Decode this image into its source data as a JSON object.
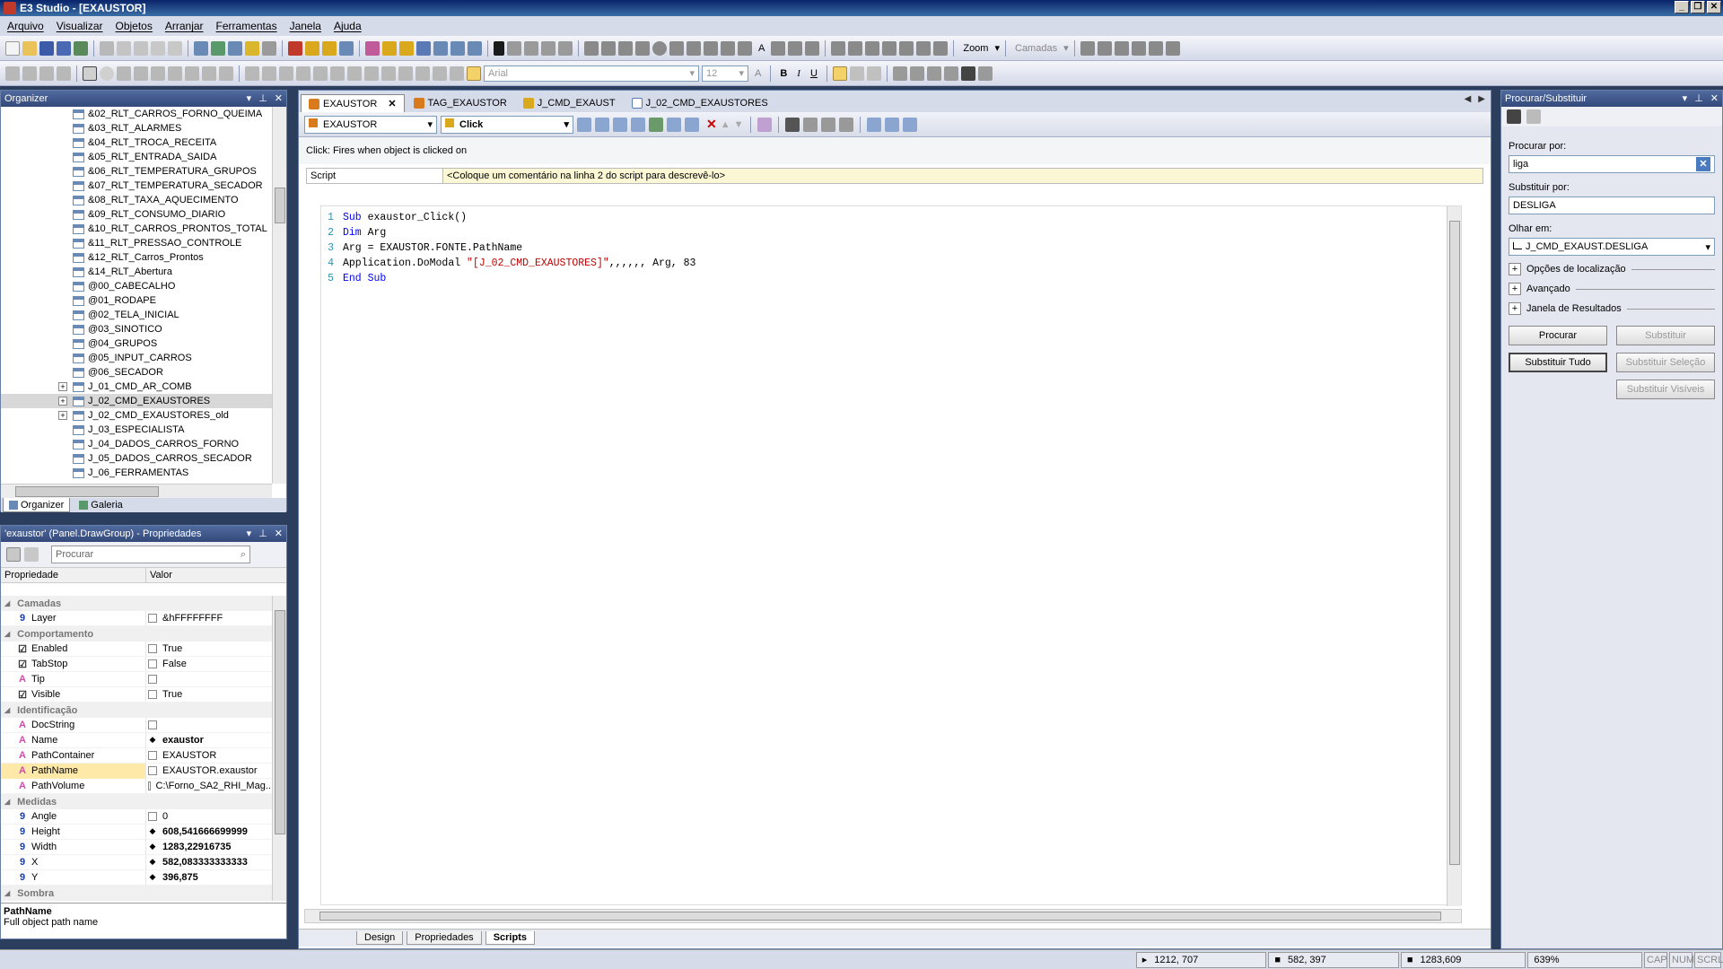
{
  "window": {
    "title": "E3 Studio - [EXAUSTOR]",
    "btn_min": "_",
    "btn_restore": "❐",
    "btn_close": "✕"
  },
  "menu": [
    "Arquivo",
    "Visualizar",
    "Objetos",
    "Arranjar",
    "Ferramentas",
    "Janela",
    "Ajuda"
  ],
  "toolbar": {
    "zoom_label": "Zoom",
    "layers_label": "Camadas",
    "font_name": "Arial",
    "font_size": "12",
    "bold": "B",
    "italic": "I",
    "underline": "U",
    "text_tool": "A"
  },
  "organizer": {
    "title": "Organizer",
    "items": [
      {
        "label": "&02_RLT_CARROS_FORNO_QUEIMA",
        "expand": ""
      },
      {
        "label": "&03_RLT_ALARMES",
        "expand": ""
      },
      {
        "label": "&04_RLT_TROCA_RECEITA",
        "expand": ""
      },
      {
        "label": "&05_RLT_ENTRADA_SAIDA",
        "expand": ""
      },
      {
        "label": "&06_RLT_TEMPERATURA_GRUPOS",
        "expand": ""
      },
      {
        "label": "&07_RLT_TEMPERATURA_SECADOR",
        "expand": ""
      },
      {
        "label": "&08_RLT_TAXA_AQUECIMENTO",
        "expand": ""
      },
      {
        "label": "&09_RLT_CONSUMO_DIARIO",
        "expand": ""
      },
      {
        "label": "&10_RLT_CARROS_PRONTOS_TOTAL",
        "expand": ""
      },
      {
        "label": "&11_RLT_PRESSAO_CONTROLE",
        "expand": ""
      },
      {
        "label": "&12_RLT_Carros_Prontos",
        "expand": ""
      },
      {
        "label": "&14_RLT_Abertura",
        "expand": ""
      },
      {
        "label": "@00_CABECALHO",
        "expand": ""
      },
      {
        "label": "@01_RODAPE",
        "expand": ""
      },
      {
        "label": "@02_TELA_INICIAL",
        "expand": ""
      },
      {
        "label": "@03_SINOTICO",
        "expand": ""
      },
      {
        "label": "@04_GRUPOS",
        "expand": ""
      },
      {
        "label": "@05_INPUT_CARROS",
        "expand": ""
      },
      {
        "label": "@06_SECADOR",
        "expand": ""
      },
      {
        "label": "J_01_CMD_AR_COMB",
        "expand": "+"
      },
      {
        "label": "J_02_CMD_EXAUSTORES",
        "expand": "+"
      },
      {
        "label": "J_02_CMD_EXAUSTORES_old",
        "expand": "+"
      },
      {
        "label": "J_03_ESPECIALISTA",
        "expand": ""
      },
      {
        "label": "J_04_DADOS_CARROS_FORNO",
        "expand": ""
      },
      {
        "label": "J_05_DADOS_CARROS_SECADOR",
        "expand": ""
      },
      {
        "label": "J_06_FERRAMENTAS",
        "expand": ""
      }
    ],
    "selected": "J_02_CMD_EXAUSTORES",
    "tabs": [
      "Organizer",
      "Galeria"
    ]
  },
  "properties": {
    "title": "'exaustor' (Panel.DrawGroup) - Propriedades",
    "search_placeholder": "Procurar",
    "col_property": "Propriedade",
    "col_value": "Valor",
    "categories": [
      {
        "name": "Camadas",
        "rows": [
          {
            "type": "9",
            "type_color": "#1a3ea8",
            "name": "Layer",
            "mark": "box",
            "value": "&hFFFFFFFF",
            "bold": false
          }
        ]
      },
      {
        "name": "Comportamento",
        "rows": [
          {
            "type": "☑",
            "type_color": "#222222",
            "name": "Enabled",
            "mark": "box",
            "value": "True",
            "bold": false
          },
          {
            "type": "☑",
            "type_color": "#222222",
            "name": "TabStop",
            "mark": "box",
            "value": "False",
            "bold": false
          },
          {
            "type": "A",
            "type_color": "#d24aa8",
            "name": "Tip",
            "mark": "box",
            "value": "",
            "bold": false
          },
          {
            "type": "☑",
            "type_color": "#222222",
            "name": "Visible",
            "mark": "box",
            "value": "True",
            "bold": false
          }
        ]
      },
      {
        "name": "Identificação",
        "rows": [
          {
            "type": "A",
            "type_color": "#d24aa8",
            "name": "DocString",
            "mark": "box",
            "value": "",
            "bold": false
          },
          {
            "type": "A",
            "type_color": "#d24aa8",
            "name": "Name",
            "mark": "diamond",
            "value": "exaustor",
            "bold": true
          },
          {
            "type": "A",
            "type_color": "#d24aa8",
            "name": "PathContainer",
            "mark": "box",
            "value": "EXAUSTOR",
            "bold": false
          },
          {
            "type": "A",
            "type_color": "#d24aa8",
            "name": "PathName",
            "mark": "box",
            "value": "EXAUSTOR.exaustor",
            "bold": false,
            "selected": true
          },
          {
            "type": "A",
            "type_color": "#d24aa8",
            "name": "PathVolume",
            "mark": "box",
            "value": "C:\\Forno_SA2_RHI_Mag...",
            "bold": false
          }
        ]
      },
      {
        "name": "Medidas",
        "rows": [
          {
            "type": "9",
            "type_color": "#1a3ea8",
            "name": "Angle",
            "mark": "box",
            "value": "0",
            "bold": false
          },
          {
            "type": "9",
            "type_color": "#1a3ea8",
            "name": "Height",
            "mark": "diamond",
            "value": "608,541666699999",
            "bold": true
          },
          {
            "type": "9",
            "type_color": "#1a3ea8",
            "name": "Width",
            "mark": "diamond",
            "value": "1283,22916735",
            "bold": true
          },
          {
            "type": "9",
            "type_color": "#1a3ea8",
            "name": "X",
            "mark": "diamond",
            "value": "582,083333333333",
            "bold": true
          },
          {
            "type": "9",
            "type_color": "#1a3ea8",
            "name": "Y",
            "mark": "diamond",
            "value": "396,875",
            "bold": true
          }
        ]
      },
      {
        "name": "Sombra",
        "rows": []
      }
    ],
    "desc_title": "PathName",
    "desc_text": "Full object path name"
  },
  "editor": {
    "tabs": [
      {
        "label": "EXAUSTOR",
        "active": true,
        "color": "#d97b1c"
      },
      {
        "label": "TAG_EXAUSTOR",
        "active": false,
        "color": "#d97b1c"
      },
      {
        "label": "J_CMD_EXAUST",
        "active": false,
        "color": "#d9a81c"
      },
      {
        "label": "J_02_CMD_EXAUSTORES",
        "active": false,
        "color": "#5a7ab6"
      }
    ],
    "object_combo": "EXAUSTOR",
    "event_combo": "Click",
    "event_description": "Click: Fires when object is clicked on",
    "script_label": "Script",
    "script_comment": "<Coloque um comentário na linha 2 do script para descrevê-lo>",
    "code": [
      {
        "n": "1",
        "parts": [
          {
            "t": "Sub",
            "c": "kw"
          },
          {
            "t": " exaustor_Click()",
            "c": ""
          }
        ]
      },
      {
        "n": "2",
        "parts": [
          {
            "t": "Dim",
            "c": "kw"
          },
          {
            "t": " Arg",
            "c": ""
          }
        ]
      },
      {
        "n": "3",
        "parts": [
          {
            "t": "Arg = EXAUSTOR.FONTE.PathName",
            "c": ""
          }
        ]
      },
      {
        "n": "4",
        "parts": [
          {
            "t": "Application.DoModal ",
            "c": ""
          },
          {
            "t": "\"[J_02_CMD_EXAUSTORES]\"",
            "c": "str"
          },
          {
            "t": ",,,,,, Arg, 83",
            "c": ""
          }
        ]
      },
      {
        "n": "5",
        "parts": [
          {
            "t": "End Sub",
            "c": "kw"
          }
        ]
      }
    ],
    "view_tabs": [
      "Design",
      "Propriedades",
      "Scripts"
    ],
    "active_view": "Scripts"
  },
  "find": {
    "title": "Procurar/Substituir",
    "search_label": "Procurar por:",
    "search_value": "liga",
    "replace_label": "Substituir por:",
    "replace_value": "DESLIGA",
    "look_label": "Olhar em:",
    "look_value": "J_CMD_EXAUST.DESLIGA",
    "expanders": [
      "Opções de localização",
      "Avançado",
      "Janela de Resultados"
    ],
    "btn_find": "Procurar",
    "btn_replace": "Substituir",
    "btn_replace_all": "Substituir Tudo",
    "btn_replace_selection": "Substituir Seleção",
    "btn_replace_visible": "Substituir Visíveis"
  },
  "status": {
    "cursor": "1212, 707",
    "position": "582, 397",
    "size": "1283,609",
    "zoom": "639%",
    "caps": "CAP",
    "num": "NUM",
    "scrl": "SCRL"
  }
}
